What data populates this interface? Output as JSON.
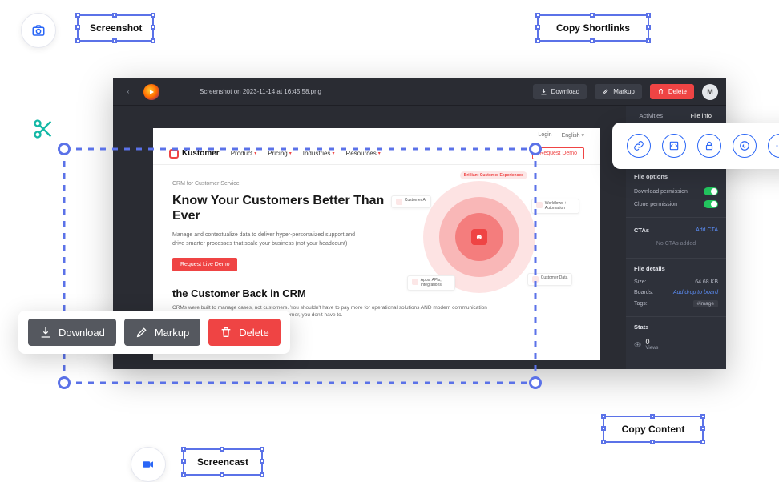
{
  "callouts": {
    "screenshot": "Screenshot",
    "copy_shortlinks": "Copy Shortlinks",
    "screencast": "Screencast",
    "copy_content": "Copy Content"
  },
  "titlebar": {
    "filename": "Screenshot on 2023-11-14 at 16:45:58.png",
    "download": "Download",
    "markup": "Markup",
    "delete": "Delete",
    "avatar_initial": "M"
  },
  "sidebar": {
    "tabs": {
      "activities": "Activities",
      "file_info": "File info"
    },
    "file_options": {
      "heading": "File options",
      "download_permission": "Download permission",
      "clone_permission": "Clone permission"
    },
    "ctas": {
      "heading": "CTAs",
      "add": "Add CTA",
      "empty": "No CTAs added"
    },
    "file_details": {
      "heading": "File details",
      "size_label": "Size:",
      "size_value": "64.68 KB",
      "boards_label": "Boards:",
      "boards_value": "Add drop to board",
      "tags_label": "Tags:",
      "tags_value": "#image"
    },
    "stats": {
      "heading": "Stats",
      "views_count": "0",
      "views_label": "Views"
    }
  },
  "canvas": {
    "top_login": "Login",
    "top_lang": "English",
    "brand": "Kustomer",
    "nav": {
      "product": "Product",
      "pricing": "Pricing",
      "industries": "Industries",
      "resources": "Resources"
    },
    "request_demo": "Request Demo",
    "eyebrow": "CRM for Customer Service",
    "hero_title": "Know Your Customers Better Than Ever",
    "hero_body": "Manage and contextualize data to deliver hyper-personalized support and drive smarter processes that scale your business (not your headcount)",
    "hero_cta": "Request Live Demo",
    "tag_brilliant": "Brilliant Customer Experiences",
    "chip_ai": "Customer AI",
    "chip_workflows": "Workflows + Automation",
    "chip_apps": "Apps, APIs, Integrations",
    "chip_data": "Customer Data",
    "sec2_title": "the Customer Back in CRM",
    "sec2_body": "CRMs were built to manage cases, not customers. You shouldn't have to pay more for operational solutions AND modern communication tools in order to provide quality support. With Kustomer, you don't have to."
  },
  "action_bar": {
    "download": "Download",
    "markup": "Markup",
    "delete": "Delete"
  }
}
